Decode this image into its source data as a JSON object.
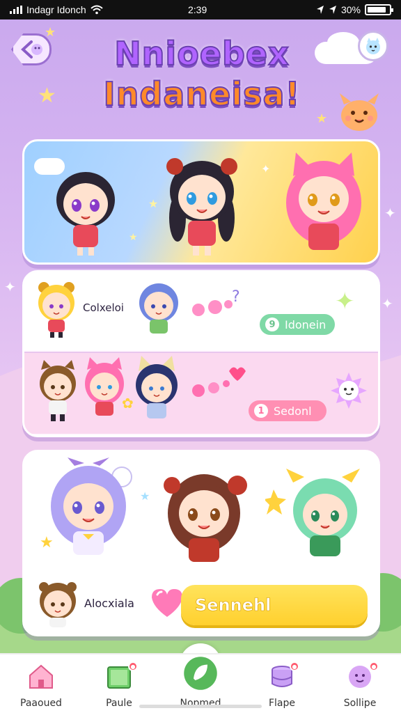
{
  "status_bar": {
    "carrier": "Indagr Idonch",
    "time": "2:39",
    "battery": "30%"
  },
  "header": {
    "title_line_1": "Nnioebex",
    "title_line_2": "Indaneisa!"
  },
  "list": {
    "row_1": {
      "label": "Colxeloi",
      "pill": "Idonein",
      "pill_icon": "9"
    },
    "row_2": {
      "pill": "Sedonl",
      "pill_icon": "1"
    }
  },
  "gallery": {
    "label": "Alocxiala",
    "search_button": "Sennehl"
  },
  "bottom_nav": {
    "items": [
      {
        "label": "Paaoued",
        "icon": "house-icon"
      },
      {
        "label": "Paule",
        "icon": "book-icon"
      },
      {
        "label": "Nopmed",
        "icon": "leaf-icon"
      },
      {
        "label": "Flape",
        "icon": "stack-icon"
      },
      {
        "label": "Sollipe",
        "icon": "face-icon"
      }
    ],
    "active_index": 2
  },
  "colors": {
    "accent": "#9b6fd1",
    "button": "#ffd02e",
    "nav_active": "#57b85a"
  }
}
